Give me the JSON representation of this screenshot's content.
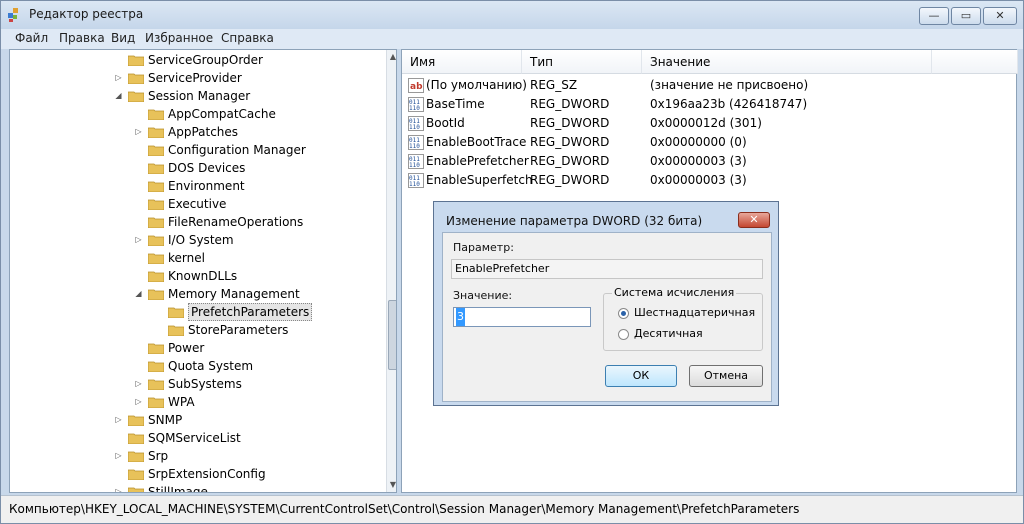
{
  "window": {
    "title": "Редактор реестра",
    "minimize": "—",
    "maximize": "▭",
    "close": "✕"
  },
  "menu": [
    "Файл",
    "Правка",
    "Вид",
    "Избранное",
    "Справка"
  ],
  "tree": {
    "items": [
      {
        "label": "ServiceGroupOrder",
        "expander": ""
      },
      {
        "label": "ServiceProvider",
        "expander": "▷"
      },
      {
        "label": "Session Manager",
        "expander": "◢"
      },
      {
        "label": "AppCompatCache",
        "expander": ""
      },
      {
        "label": "AppPatches",
        "expander": "▷"
      },
      {
        "label": "Configuration Manager",
        "expander": ""
      },
      {
        "label": "DOS Devices",
        "expander": ""
      },
      {
        "label": "Environment",
        "expander": ""
      },
      {
        "label": "Executive",
        "expander": ""
      },
      {
        "label": "FileRenameOperations",
        "expander": ""
      },
      {
        "label": "I/O System",
        "expander": "▷"
      },
      {
        "label": "kernel",
        "expander": ""
      },
      {
        "label": "KnownDLLs",
        "expander": ""
      },
      {
        "label": "Memory Management",
        "expander": "◢"
      },
      {
        "label": "PrefetchParameters",
        "expander": ""
      },
      {
        "label": "StoreParameters",
        "expander": ""
      },
      {
        "label": "Power",
        "expander": ""
      },
      {
        "label": "Quota System",
        "expander": ""
      },
      {
        "label": "SubSystems",
        "expander": "▷"
      },
      {
        "label": "WPA",
        "expander": "▷"
      },
      {
        "label": "SNMP",
        "expander": "▷"
      },
      {
        "label": "SQMServiceList",
        "expander": ""
      },
      {
        "label": "Srp",
        "expander": "▷"
      },
      {
        "label": "SrpExtensionConfig",
        "expander": ""
      },
      {
        "label": "StillImage",
        "expander": "▷"
      }
    ],
    "scroll_up": "▲",
    "scroll_down": "▼"
  },
  "list": {
    "headers": [
      "Имя",
      "Тип",
      "Значение"
    ],
    "rows": [
      {
        "icon": "ab",
        "name": "(По умолчанию)",
        "type": "REG_SZ",
        "value": "(значение не присвоено)"
      },
      {
        "icon": "011",
        "name": "BaseTime",
        "type": "REG_DWORD",
        "value": "0x196aa23b (426418747)"
      },
      {
        "icon": "011",
        "name": "BootId",
        "type": "REG_DWORD",
        "value": "0x0000012d (301)"
      },
      {
        "icon": "011",
        "name": "EnableBootTrace",
        "type": "REG_DWORD",
        "value": "0x00000000 (0)"
      },
      {
        "icon": "011",
        "name": "EnablePrefetcher",
        "type": "REG_DWORD",
        "value": "0x00000003 (3)"
      },
      {
        "icon": "011",
        "name": "EnableSuperfetch",
        "type": "REG_DWORD",
        "value": "0x00000003 (3)"
      }
    ]
  },
  "status": "Компьютер\\HKEY_LOCAL_MACHINE\\SYSTEM\\CurrentControlSet\\Control\\Session Manager\\Memory Management\\PrefetchParameters",
  "dialog": {
    "title": "Изменение параметра DWORD (32 бита)",
    "close": "✕",
    "param_label": "Параметр:",
    "param_value": "EnablePrefetcher",
    "value_label": "Значение:",
    "value": "3",
    "radix_title": "Система исчисления",
    "radix_hex": "Шестнадцатеричная",
    "radix_dec": "Десятичная",
    "radix_selected": "hex",
    "ok": "ОК",
    "cancel": "Отмена"
  }
}
